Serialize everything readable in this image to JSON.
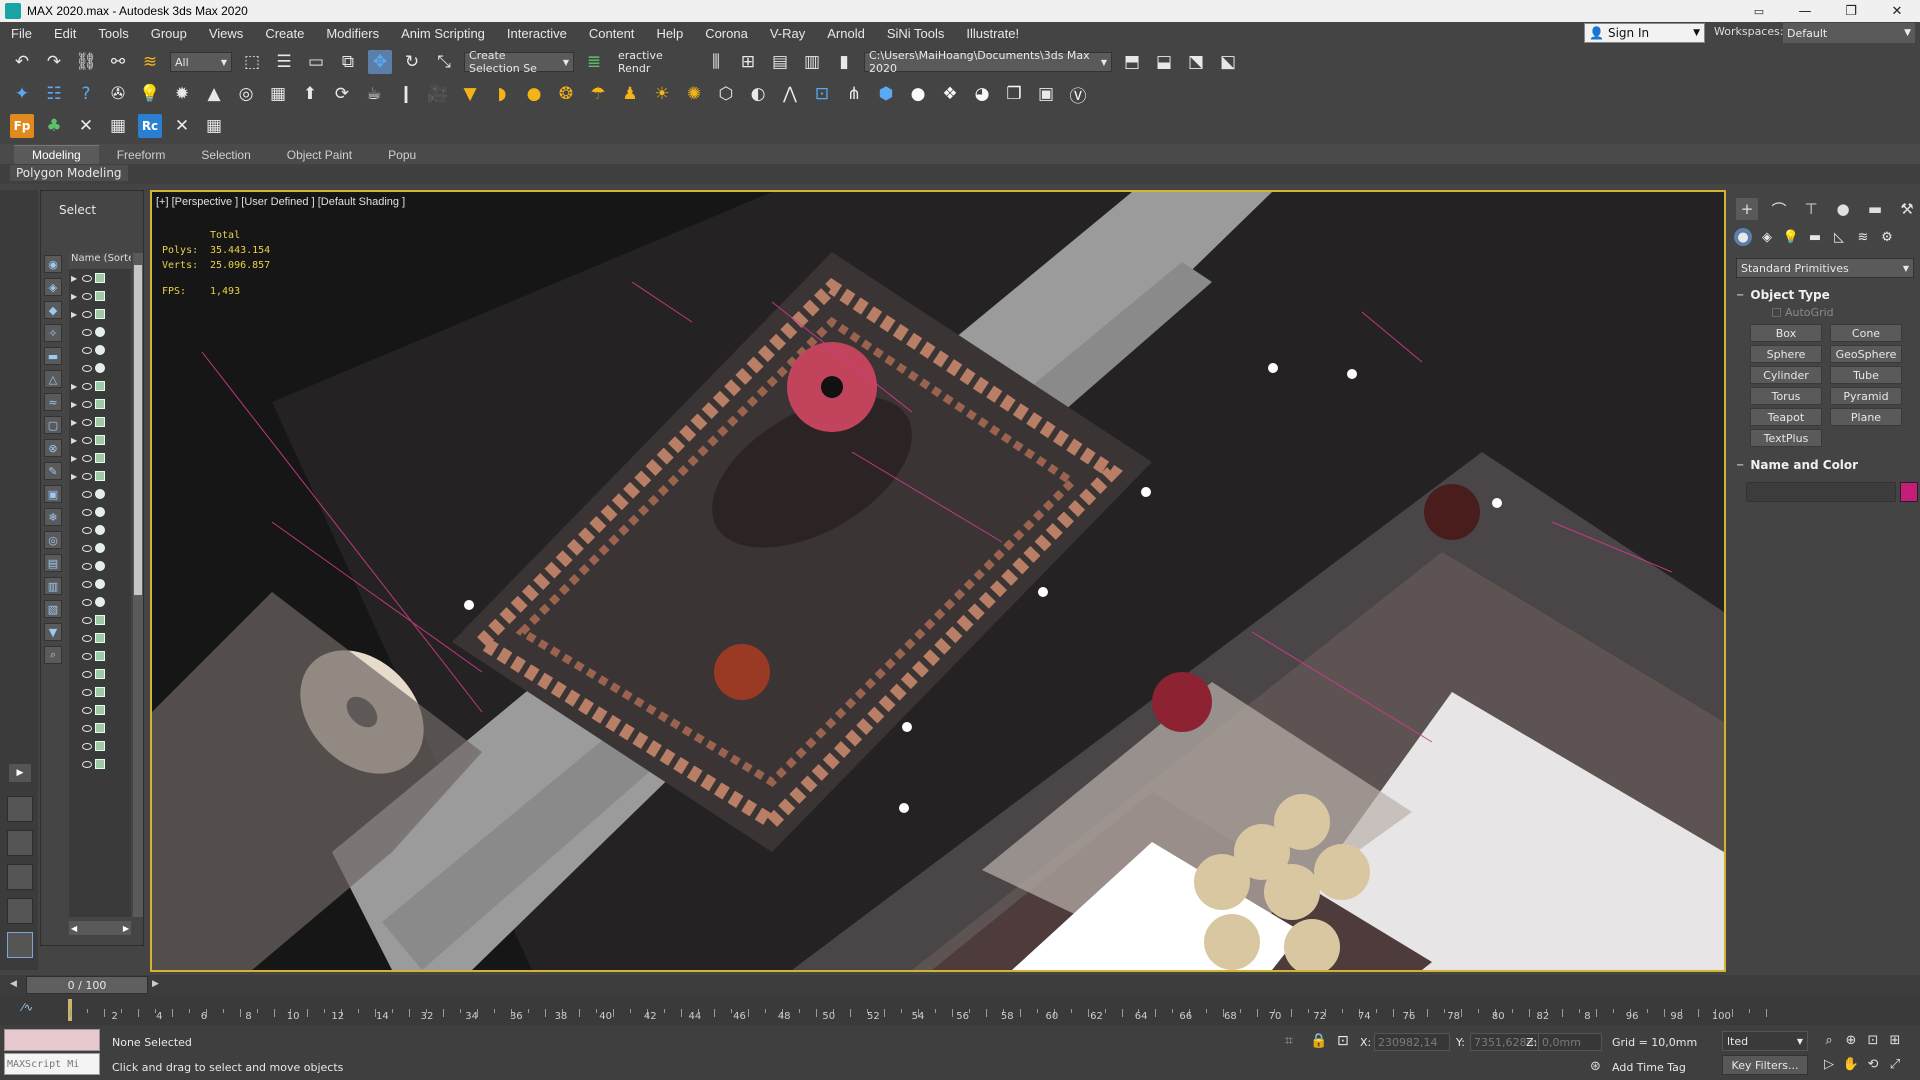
{
  "window": {
    "title": "MAX 2020.max - Autodesk 3ds Max 2020",
    "buttons": {
      "minimize": "—",
      "maximize": "❐",
      "close": "✕"
    }
  },
  "menubar": {
    "items": [
      "File",
      "Edit",
      "Tools",
      "Group",
      "Views",
      "Create",
      "Modifiers",
      "Anim Scripting",
      "Interactive",
      "Content",
      "Help",
      "Corona",
      "V-Ray",
      "Arnold",
      "SiNi Tools",
      "Illustrate!"
    ],
    "sign_in": "Sign In",
    "workspaces_label": "Workspaces:",
    "workspace_value": "Default"
  },
  "toolbar": {
    "filter_value": "All",
    "selection_set": "Create Selection Se",
    "interactive_render": "eractive Rendr",
    "project_path": "C:\\Users\\MaiHoang\\Documents\\3ds Max 2020"
  },
  "ribbon": {
    "tabs": [
      "Modeling",
      "Freeform",
      "Selection",
      "Object Paint",
      "Popu"
    ],
    "active_tab": "Modeling",
    "subpanel": "Polygon Modeling"
  },
  "scene_explorer": {
    "select_label": "Select",
    "column_header": "Name (Sorted A",
    "row_count": 28
  },
  "viewport": {
    "label": "[+] [Perspective ] [User Defined ] [Default Shading ]",
    "stats": {
      "total_label": "Total",
      "polys_label": "Polys:",
      "polys": "35.443.154",
      "verts_label": "Verts:",
      "verts": "25.096.857",
      "fps_label": "FPS:",
      "fps": "1,493"
    },
    "border_color": "#d3b32f"
  },
  "command_panel": {
    "dropdown": "Standard Primitives",
    "object_type_title": "Object Type",
    "autogrid": "AutoGrid",
    "object_buttons": [
      "Box",
      "Cone",
      "Sphere",
      "GeoSphere",
      "Cylinder",
      "Tube",
      "Torus",
      "Pyramid",
      "Teapot",
      "Plane",
      "TextPlus"
    ],
    "name_color_title": "Name and Color",
    "object_color": "#c51d79"
  },
  "timeline": {
    "frame_display": "0 / 100",
    "ticks": [
      "2",
      "4",
      "6",
      "8",
      "10",
      "12",
      "14",
      "32",
      "34",
      "36",
      "38",
      "40",
      "42",
      "44",
      "46",
      "48",
      "50",
      "52",
      "54",
      "56",
      "58",
      "60",
      "62",
      "64",
      "66",
      "68",
      "70",
      "72",
      "74",
      "76",
      "78",
      "80",
      "82",
      "8",
      "96",
      "98",
      "100"
    ]
  },
  "statusbar": {
    "maxscript_label": "MAXScript Mi",
    "selection_status": "None Selected",
    "prompt": "Click and drag to select and move objects",
    "x_label": "X:",
    "x_value": "230982,14",
    "y_label": "Y:",
    "y_value": "7351,628m",
    "z_label": "Z:",
    "z_value": "0,0mm",
    "grid": "Grid = 10,0mm",
    "add_time_tag": "Add Time Tag",
    "key_mode": "lted",
    "key_filters": "Key Filters..."
  }
}
